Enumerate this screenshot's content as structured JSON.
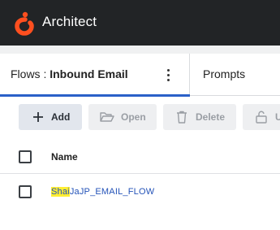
{
  "app": {
    "title": "Architect",
    "logo": "genesys-logo",
    "brand_color": "#ff4f1f",
    "topbar_color": "#222426"
  },
  "tabs": {
    "active": {
      "prefix": "Flows : ",
      "name": "Inbound Email",
      "menu_icon": "kebab-menu-icon"
    },
    "items": [
      {
        "label": "Prompts"
      }
    ],
    "active_color": "#2a60c8"
  },
  "toolbar": {
    "add_label": "Add",
    "open_label": "Open",
    "delete_label": "Delete",
    "unlock_label": "U"
  },
  "table": {
    "columns": [
      "Name"
    ],
    "rows": [
      {
        "name_highlight": "Shai",
        "name_rest": "JaJP_EMAIL_FLOW"
      }
    ],
    "link_color": "#2453b8",
    "highlight_color": "#ffee33"
  }
}
